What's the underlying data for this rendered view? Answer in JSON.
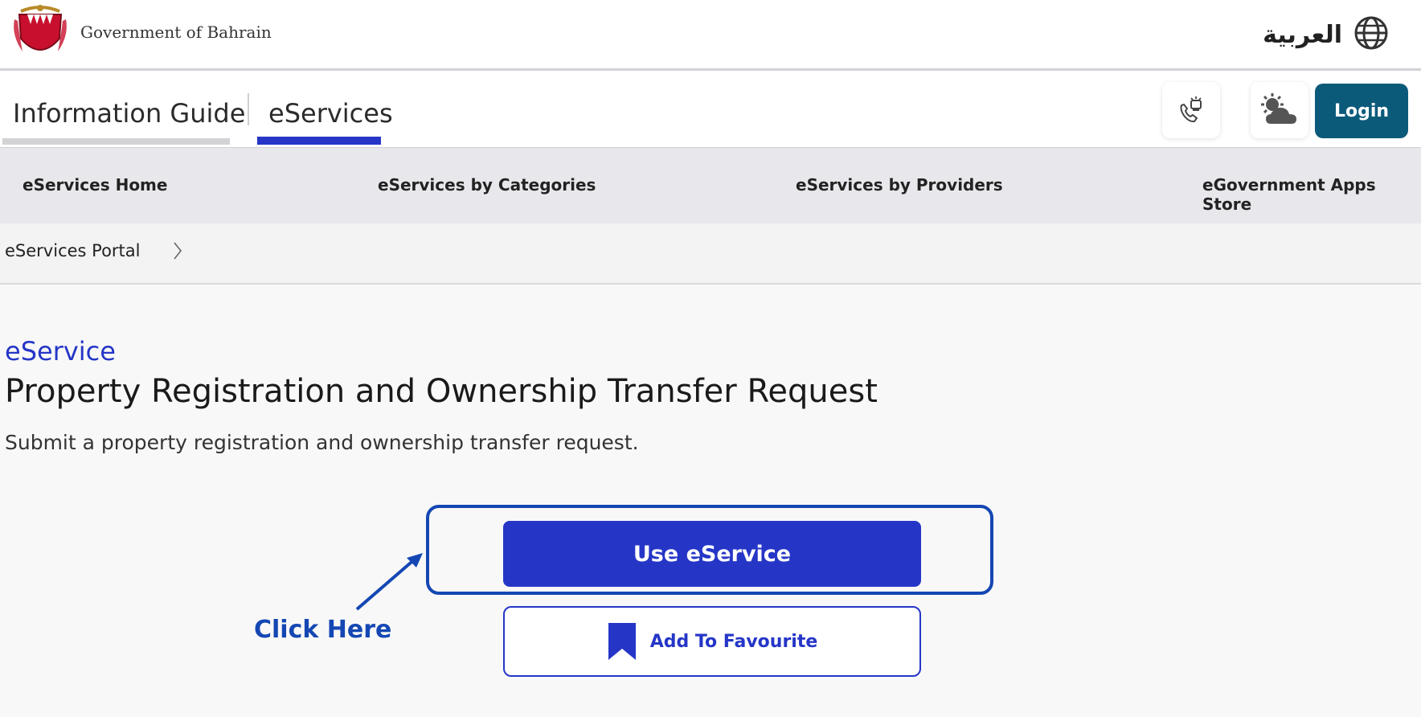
{
  "header": {
    "gov_name": "Government of Bahrain",
    "language_label": "العربية"
  },
  "nav": {
    "tabs": [
      {
        "label": "Information Guide",
        "active": false
      },
      {
        "label": "eServices",
        "active": true
      }
    ],
    "login_label": "Login"
  },
  "subnav": {
    "items": [
      {
        "label": "eServices Home"
      },
      {
        "label": "eServices by Categories"
      },
      {
        "label": "eServices by Providers"
      },
      {
        "label": "eGovernment Apps Store"
      }
    ]
  },
  "breadcrumb": {
    "items": [
      {
        "label": "eServices Portal"
      }
    ]
  },
  "main": {
    "kicker": "eService",
    "title": "Property Registration and Ownership Transfer Request",
    "description": "Submit a property registration and ownership transfer request.",
    "use_button": "Use eService",
    "favourite_button": "Add To Favourite"
  },
  "annotation": {
    "label": "Click Here"
  },
  "icons": {
    "logo": "bahrain-emblem-icon",
    "language": "globe-icon",
    "phone": "emergency-phone-icon",
    "weather": "weather-icon",
    "breadcrumb": "chevron-right-icon",
    "favourite": "bookmark-icon"
  },
  "colors": {
    "accent": "#2536c7",
    "login": "#0c5a7a",
    "annotation": "#1447b3"
  }
}
